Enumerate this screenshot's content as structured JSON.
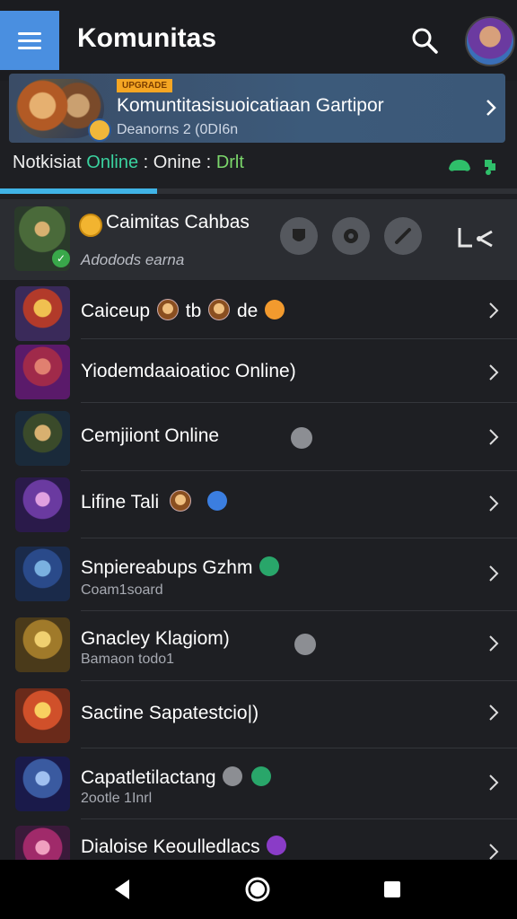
{
  "app": {
    "title": "Komunitas"
  },
  "banner": {
    "tag": "UPGRADE",
    "title": "Komuntitasisuoicatiaan Gartipor",
    "subtitle": "Deanorns 2 (0DI6n"
  },
  "status": {
    "part1": "Notkisiat",
    "part2": "Online",
    "part3": ": Onine :",
    "part4": "Drlt"
  },
  "featured": {
    "title": "Caimitas Cahbas",
    "subtitle": "Adodods earna"
  },
  "list": [
    {
      "title": "Caiceup",
      "title_extra1": "tb",
      "title_extra2": "de",
      "subtitle": ""
    },
    {
      "title": "Yiodemdaaioatioc Online)",
      "subtitle": ""
    },
    {
      "title": "Cemjiiont Online",
      "subtitle": ""
    },
    {
      "title": "Lifine Tali",
      "subtitle": ""
    },
    {
      "title": "Snpiereabups Gzhm",
      "subtitle": "Coam1soard"
    },
    {
      "title": "Gnacley Klagiom)",
      "subtitle": "Bamaon todo1"
    },
    {
      "title": "Sactine Sapatestcio|)",
      "subtitle": ""
    },
    {
      "title": "Capatletilactang",
      "subtitle": "2ootle 1Inrl"
    },
    {
      "title": "Dialoise Keoulledlacs",
      "subtitle": ""
    }
  ],
  "colors": {
    "accent_blue": "#4a8fe0",
    "tab_indicator": "#40b3e6",
    "online_green": "#3ad29f"
  }
}
